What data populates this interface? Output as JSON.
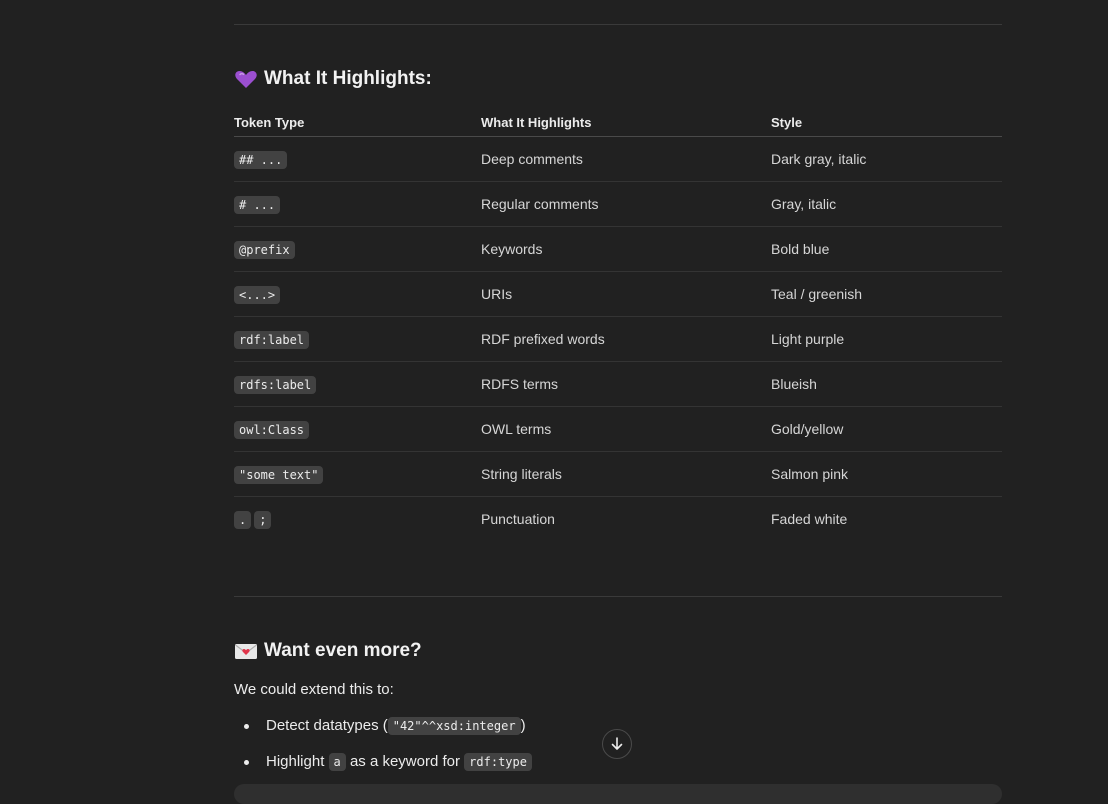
{
  "section1": {
    "emoji": "purple-heart",
    "title": "What It Highlights:"
  },
  "table": {
    "headers": [
      "Token Type",
      "What It Highlights",
      "Style"
    ],
    "rows": [
      {
        "token": [
          "## ..."
        ],
        "highlights": "Deep comments",
        "style": "Dark gray, italic"
      },
      {
        "token": [
          "# ..."
        ],
        "highlights": "Regular comments",
        "style": "Gray, italic"
      },
      {
        "token": [
          "@prefix"
        ],
        "highlights": "Keywords",
        "style": "Bold blue"
      },
      {
        "token": [
          "<...>"
        ],
        "highlights": "URIs",
        "style": "Teal / greenish"
      },
      {
        "token": [
          "rdf:label"
        ],
        "highlights": "RDF prefixed words",
        "style": "Light purple"
      },
      {
        "token": [
          "rdfs:label"
        ],
        "highlights": "RDFS terms",
        "style": "Blueish"
      },
      {
        "token": [
          "owl:Class"
        ],
        "highlights": "OWL terms",
        "style": "Gold/yellow"
      },
      {
        "token": [
          "\"some text\""
        ],
        "highlights": "String literals",
        "style": "Salmon pink"
      },
      {
        "token": [
          ".",
          ";"
        ],
        "highlights": "Punctuation",
        "style": "Faded white"
      }
    ]
  },
  "section2": {
    "emoji": "love-letter",
    "title": "Want even more?",
    "intro": "We could extend this to:",
    "bullets": [
      {
        "before": "Detect datatypes (",
        "code": "\"42\"^^xsd:integer",
        "after": ")"
      },
      {
        "before": "Highlight ",
        "code": "a",
        "middle": " as a keyword for ",
        "code2": "rdf:type"
      }
    ]
  },
  "colors": {
    "background": "#212121",
    "text": "#ececec",
    "code_bg": "#424242",
    "divider": "#3a3a3a"
  },
  "icons": {
    "scroll_down": "arrow-down-icon"
  }
}
